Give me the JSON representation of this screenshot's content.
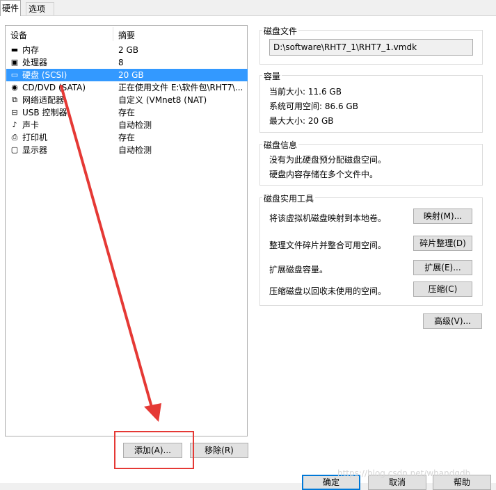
{
  "tabs": [
    {
      "label": "硬件",
      "active": true
    },
    {
      "label": "选项",
      "active": false
    }
  ],
  "device_list": {
    "headers": {
      "device": "设备",
      "summary": "摘要"
    },
    "rows": [
      {
        "icon": "memory-icon",
        "glyph": "▬",
        "name": "内存",
        "summary": "2 GB",
        "selected": false
      },
      {
        "icon": "cpu-icon",
        "glyph": "▣",
        "name": "处理器",
        "summary": "8",
        "selected": false
      },
      {
        "icon": "hard-disk-icon",
        "glyph": "▭",
        "name": "硬盘 (SCSI)",
        "summary": "20 GB",
        "selected": true
      },
      {
        "icon": "cd-dvd-icon",
        "glyph": "◉",
        "name": "CD/DVD (SATA)",
        "summary": "正在使用文件 E:\\软件包\\RHT7\\...",
        "selected": false
      },
      {
        "icon": "network-adapter-icon",
        "glyph": "⧉",
        "name": "网络适配器",
        "summary": "自定义 (VMnet8 (NAT)",
        "selected": false
      },
      {
        "icon": "usb-icon",
        "glyph": "⊟",
        "name": "USB 控制器",
        "summary": "存在",
        "selected": false
      },
      {
        "icon": "sound-card-icon",
        "glyph": "♪",
        "name": "声卡",
        "summary": "自动检测",
        "selected": false
      },
      {
        "icon": "printer-icon",
        "glyph": "⎙",
        "name": "打印机",
        "summary": "存在",
        "selected": false
      },
      {
        "icon": "display-icon",
        "glyph": "▢",
        "name": "显示器",
        "summary": "自动检测",
        "selected": false
      }
    ]
  },
  "buttons": {
    "add": "添加(A)...",
    "remove": "移除(R)",
    "advanced": "高级(V)...",
    "ok": "确定",
    "cancel": "取消",
    "help": "帮助"
  },
  "disk_file": {
    "title": "磁盘文件",
    "value": "D:\\software\\RHT7_1\\RHT7_1.vmdk"
  },
  "capacity": {
    "title": "容量",
    "current_size": "当前大小: 11.6 GB",
    "system_free": "系统可用空间: 86.6 GB",
    "max_size": "最大大小: 20 GB"
  },
  "disk_info": {
    "title": "磁盘信息",
    "line1": "没有为此硬盘预分配磁盘空间。",
    "line2": "硬盘内容存储在多个文件中。"
  },
  "disk_utilities": {
    "title": "磁盘实用工具",
    "items": [
      {
        "text": "将该虚拟机磁盘映射到本地卷。",
        "button": "映射(M)..."
      },
      {
        "text": "整理文件碎片并整合可用空间。",
        "button": "碎片整理(D)"
      },
      {
        "text": "扩展磁盘容量。",
        "button": "扩展(E)..."
      },
      {
        "text": "压缩磁盘以回收未使用的空间。",
        "button": "压缩(C)"
      }
    ]
  },
  "watermark": "https://blog.csdn.net/whandgdh",
  "colors": {
    "selection": "#3399ff",
    "annotation": "#e53935"
  }
}
